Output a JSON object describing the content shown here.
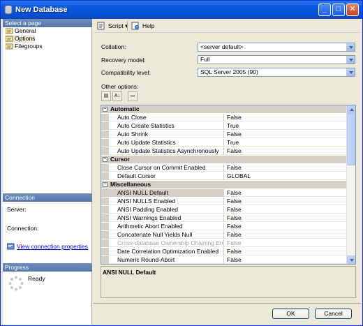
{
  "window": {
    "title": "New Database"
  },
  "left": {
    "select_page_header": "Select a page",
    "pages": [
      {
        "label": "General"
      },
      {
        "label": "Options"
      },
      {
        "label": "Filegroups"
      }
    ],
    "connection_header": "Connection",
    "server_label": "Server:",
    "connection_label": "Connection:",
    "view_connection_link": "View connection properties",
    "progress_header": "Progress",
    "progress_status": "Ready"
  },
  "toolbar": {
    "script_label": "Script",
    "help_label": "Help"
  },
  "form": {
    "collation_label": "Collation:",
    "collation_value": "<server default>",
    "recovery_label": "Recovery model:",
    "recovery_value": "Full",
    "compat_label": "Compatibility level:",
    "compat_value": "SQL Server 2005 (90)",
    "other_options_label": "Other options:"
  },
  "grid": {
    "categories": [
      "Automatic",
      "Cursor",
      "Miscellaneous"
    ],
    "automatic": [
      {
        "name": "Auto Close",
        "value": "False"
      },
      {
        "name": "Auto Create Statistics",
        "value": "True"
      },
      {
        "name": "Auto Shrink",
        "value": "False"
      },
      {
        "name": "Auto Update Statistics",
        "value": "True"
      },
      {
        "name": "Auto Update Statistics Asynchronously",
        "value": "False"
      }
    ],
    "cursor": [
      {
        "name": "Close Cursor on Commit Enabled",
        "value": "False"
      },
      {
        "name": "Default Cursor",
        "value": "GLOBAL"
      }
    ],
    "misc": [
      {
        "name": "ANSI NULL Default",
        "value": "False"
      },
      {
        "name": "ANSI NULLS Enabled",
        "value": "False"
      },
      {
        "name": "ANSI Padding Enabled",
        "value": "False"
      },
      {
        "name": "ANSI Warnings Enabled",
        "value": "False"
      },
      {
        "name": "Arithmetic Abort Enabled",
        "value": "False"
      },
      {
        "name": "Concatenate Null Yields Null",
        "value": "False"
      },
      {
        "name": "Cross-database Ownership Chaining Enabled",
        "value": "False"
      },
      {
        "name": "Date Correlation Optimization Enabled",
        "value": "False"
      },
      {
        "name": "Numeric Round-Abort",
        "value": "False"
      }
    ]
  },
  "description": {
    "title": "ANSI NULL Default"
  },
  "buttons": {
    "ok": "OK",
    "cancel": "Cancel"
  }
}
